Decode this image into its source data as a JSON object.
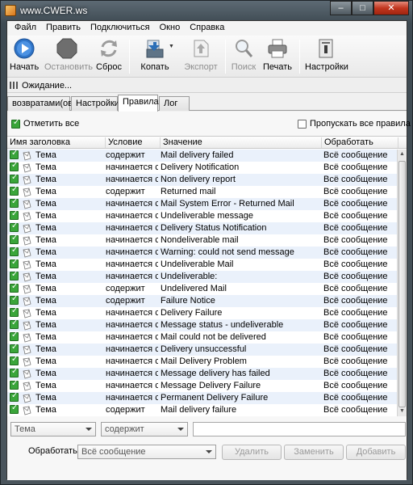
{
  "window": {
    "title": "www.CWER.ws",
    "controls": {
      "minimize": "–",
      "maximize": "□",
      "close": "✕"
    }
  },
  "menu": [
    "Файл",
    "Править",
    "Подключиться",
    "Окно",
    "Справка"
  ],
  "toolbar": {
    "start": "Начать",
    "stop": "Остановить",
    "reset": "Сброс",
    "copy": "Копать",
    "export": "Экспорт",
    "search": "Поиск",
    "print": "Печать",
    "settings": "Настройки"
  },
  "status": {
    "text": "Ожидание..."
  },
  "tabs": [
    "возвратами(ов)",
    "Настройки",
    "Правила",
    "Лог"
  ],
  "active_tab": "Правила",
  "rules_panel": {
    "check_all": "Отметить все",
    "skip_all": "Пропускать все правила",
    "columns": [
      "Имя заголовка",
      "Условие",
      "Значение",
      "Обработать"
    ],
    "rows": [
      {
        "field": "Тема",
        "condition": "содержит",
        "value": "Mail delivery failed",
        "action": "Всё сообщение"
      },
      {
        "field": "Тема",
        "condition": "начинается с",
        "value": "Delivery Notification",
        "action": "Всё сообщение"
      },
      {
        "field": "Тема",
        "condition": "начинается с",
        "value": "Non delivery report",
        "action": "Всё сообщение"
      },
      {
        "field": "Тема",
        "condition": "содержит",
        "value": "Returned mail",
        "action": "Всё сообщение"
      },
      {
        "field": "Тема",
        "condition": "начинается с",
        "value": "Mail System Error - Returned Mail",
        "action": "Всё сообщение"
      },
      {
        "field": "Тема",
        "condition": "начинается с",
        "value": "Undeliverable message",
        "action": "Всё сообщение"
      },
      {
        "field": "Тема",
        "condition": "начинается с",
        "value": "Delivery Status Notification",
        "action": "Всё сообщение"
      },
      {
        "field": "Тема",
        "condition": "начинается с",
        "value": "Nondeliverable mail",
        "action": "Всё сообщение"
      },
      {
        "field": "Тема",
        "condition": "начинается с",
        "value": "Warning: could not send message",
        "action": "Всё сообщение"
      },
      {
        "field": "Тема",
        "condition": "начинается с",
        "value": "Undeliverable Mail",
        "action": "Всё сообщение"
      },
      {
        "field": "Тема",
        "condition": "начинается с",
        "value": "Undeliverable:",
        "action": "Всё сообщение"
      },
      {
        "field": "Тема",
        "condition": "содержит",
        "value": "Undelivered Mail",
        "action": "Всё сообщение"
      },
      {
        "field": "Тема",
        "condition": "содержит",
        "value": "Failure Notice",
        "action": "Всё сообщение"
      },
      {
        "field": "Тема",
        "condition": "начинается с",
        "value": "Delivery Failure",
        "action": "Всё сообщение"
      },
      {
        "field": "Тема",
        "condition": "начинается с",
        "value": "Message status - undeliverable",
        "action": "Всё сообщение"
      },
      {
        "field": "Тема",
        "condition": "начинается с",
        "value": "Mail could not be delivered",
        "action": "Всё сообщение"
      },
      {
        "field": "Тема",
        "condition": "начинается с",
        "value": "Delivery unsuccessful",
        "action": "Всё сообщение"
      },
      {
        "field": "Тема",
        "condition": "начинается с",
        "value": "Mail Delivery Problem",
        "action": "Всё сообщение"
      },
      {
        "field": "Тема",
        "condition": "начинается с",
        "value": "Message delivery has failed",
        "action": "Всё сообщение"
      },
      {
        "field": "Тема",
        "condition": "начинается с",
        "value": "Message Delivery Failure",
        "action": "Всё сообщение"
      },
      {
        "field": "Тема",
        "condition": "начинается с",
        "value": "Permanent Delivery Failure",
        "action": "Всё сообщение"
      },
      {
        "field": "Тема",
        "condition": "содержит",
        "value": "Mail delivery failure",
        "action": "Всё сообщение"
      }
    ]
  },
  "editor": {
    "field_select": "Тема",
    "condition_select": "содержит",
    "value_input": "",
    "action_label": "Обработать:",
    "action_select": "Всё сообщение",
    "delete_button": "Удалить",
    "replace_button": "Заменить",
    "add_button": "Добавить"
  },
  "colors": {
    "checkbox_green": "#3aa53a",
    "row_stripe": "#eaf1fb",
    "titlebar": "#4a555c"
  }
}
